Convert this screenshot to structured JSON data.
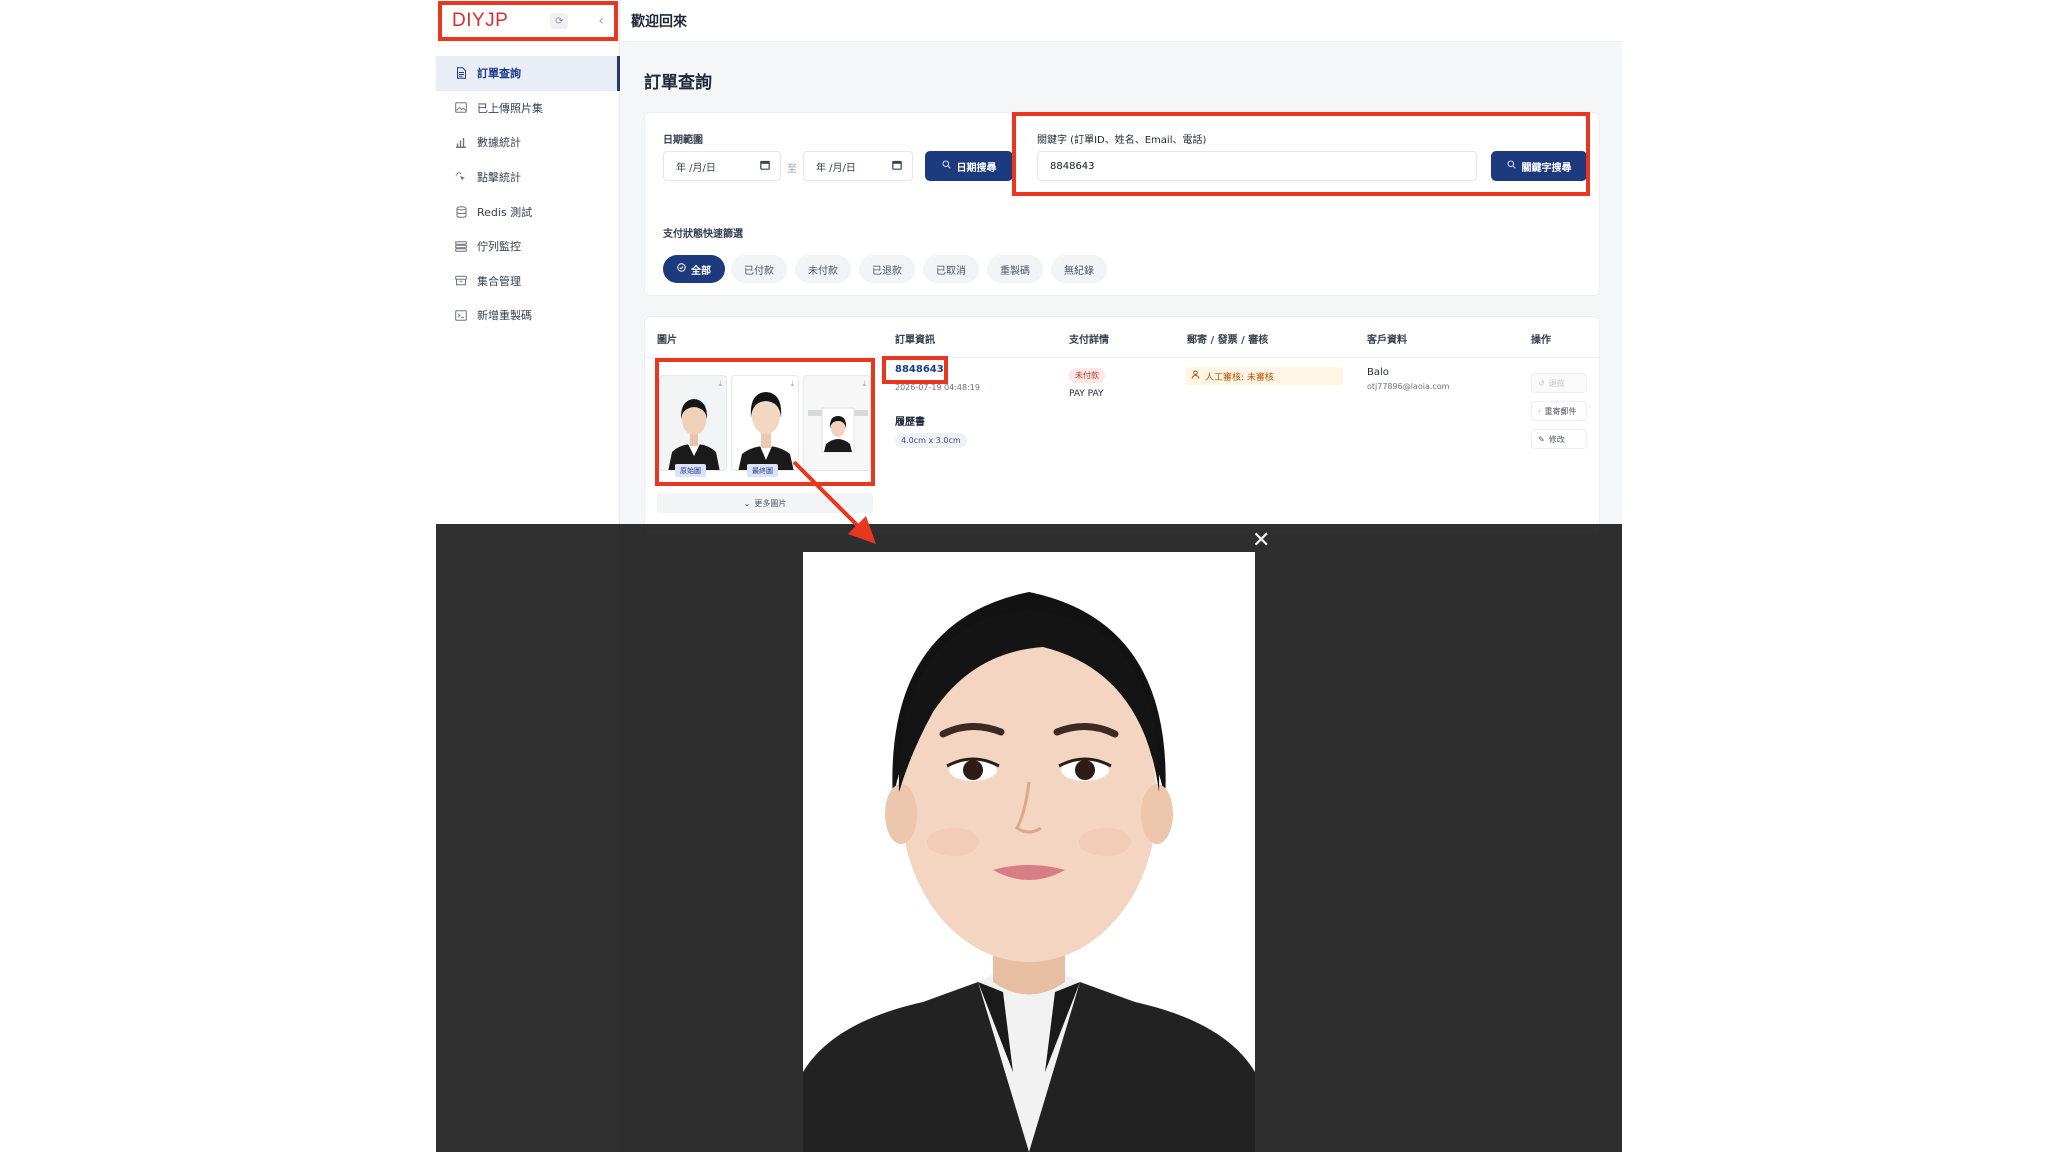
{
  "sidebar": {
    "brand": "DIYJP",
    "refresh_icon": "⟳",
    "collapse_icon": "‹",
    "items": [
      {
        "label": "訂單查詢",
        "icon": "document-icon",
        "active": true
      },
      {
        "label": "已上傳照片集",
        "icon": "image-icon",
        "active": false
      },
      {
        "label": "數據統計",
        "icon": "bar-chart-icon",
        "active": false
      },
      {
        "label": "點擊統計",
        "icon": "click-icon",
        "active": false
      },
      {
        "label": "Redis 測試",
        "icon": "database-icon",
        "active": false
      },
      {
        "label": "佇列監控",
        "icon": "queue-icon",
        "active": false
      },
      {
        "label": "集合管理",
        "icon": "box-icon",
        "active": false
      },
      {
        "label": "新增重製碼",
        "icon": "terminal-icon",
        "active": false
      }
    ]
  },
  "header": {
    "welcome": "歡迎回來"
  },
  "page": {
    "title": "訂單查詢"
  },
  "filters": {
    "date_label": "日期範圍",
    "date_start": "年 /月/日",
    "date_end": "年 /月/日",
    "date_sep": "至",
    "date_search_button": "日期搜尋",
    "keyword_label": "關鍵字 (訂單ID、姓名、Email、電話)",
    "keyword_value": "8848643",
    "keyword_search_button": "關鍵字搜尋",
    "status_label": "支付狀態快速篩選",
    "status_pills": [
      "全部",
      "已付款",
      "未付款",
      "已退款",
      "已取消",
      "重製碼",
      "無紀錄"
    ]
  },
  "table": {
    "headers": [
      "圖片",
      "訂單資訊",
      "支付詳情",
      "郵寄 / 發票 / 審核",
      "客戶資料",
      "操作"
    ],
    "row": {
      "image_tags": [
        "原始圖",
        "最終圖"
      ],
      "more_images": "更多圖片",
      "order_id": "8848643",
      "order_time": "2026-07-19 04:48:19",
      "doc_type": "履歷書",
      "size": "4.0cm x 3.0cm",
      "pay_status": "未付款",
      "pay_method": "PAY PAY",
      "review": "人工審核: 未審核",
      "customer_name": "Balo",
      "customer_email": "otj77896@laoia.com",
      "actions": [
        "退款",
        "重寄郵件",
        "修改"
      ]
    }
  },
  "modal": {
    "close_icon": "✕"
  },
  "colors": {
    "brand_red": "#d2322d",
    "primary": "#1c3a7d",
    "callout": "#e8361f"
  }
}
